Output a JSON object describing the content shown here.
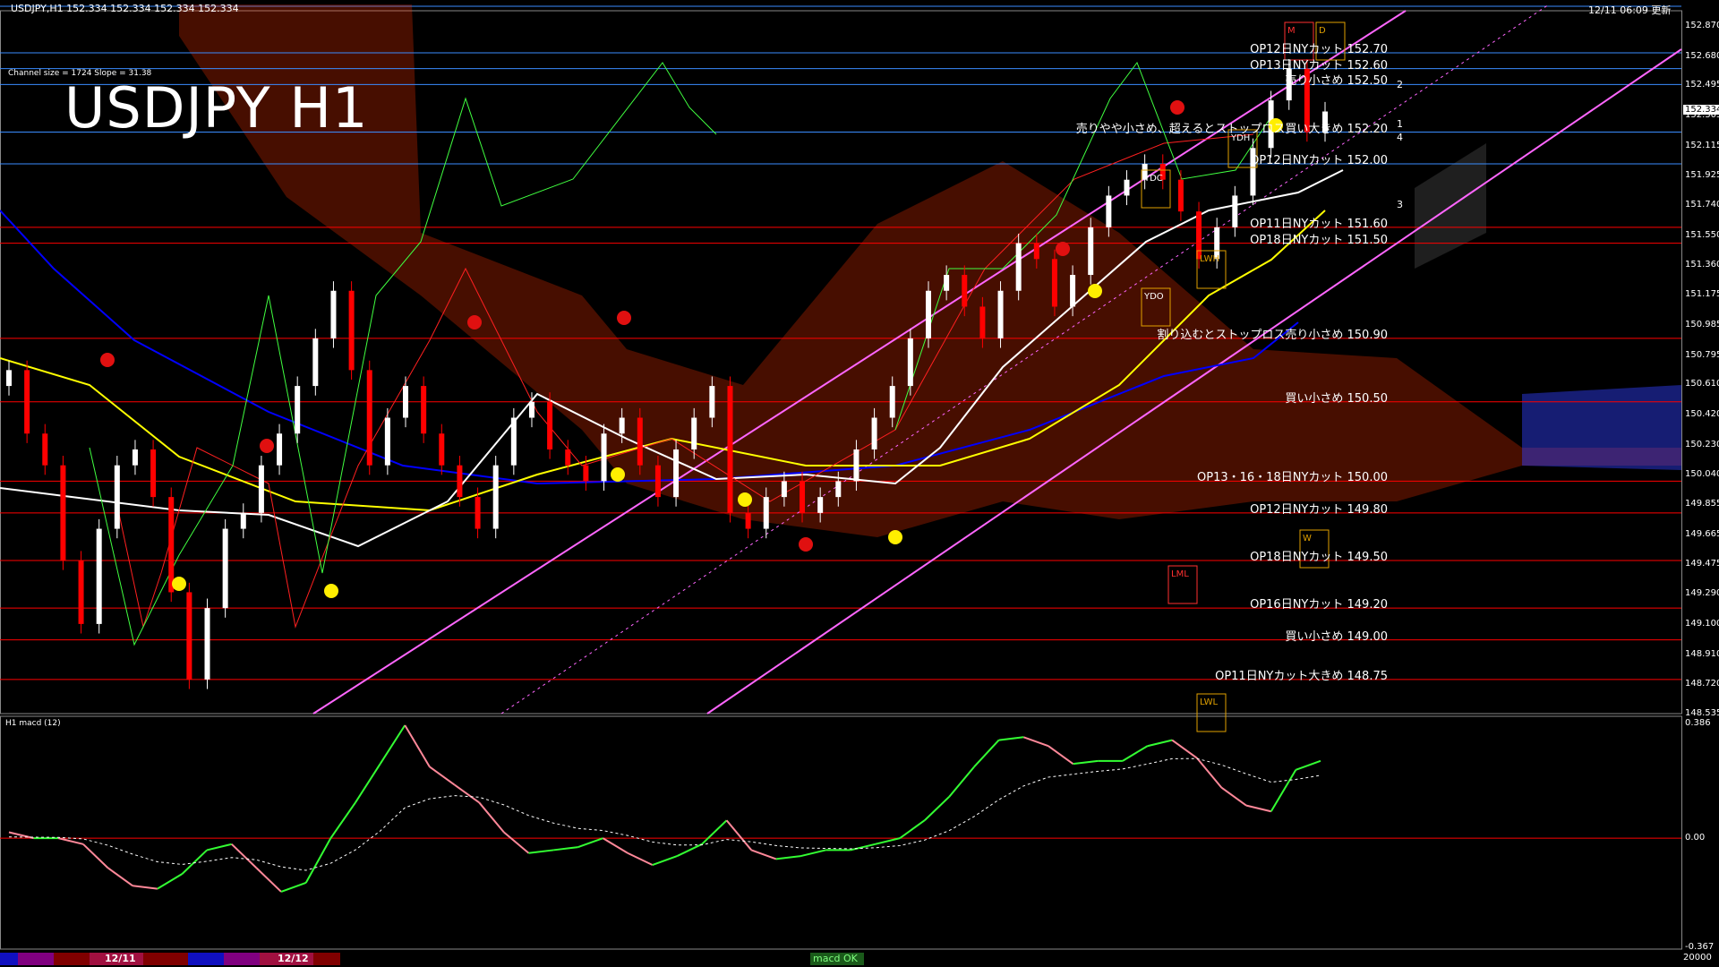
{
  "header": {
    "symbol_info": "USDJPY,H1  152.334 152.334 152.334 152.334",
    "timestamp": "12/11 06:09 更新",
    "channel_info": "Channel size = 1724 Slope = 31.38"
  },
  "chart_data": {
    "type": "candlestick",
    "title": "USDJPY H1",
    "ylim": [
      148.535,
      152.965
    ],
    "y_ticks": [
      "152.870",
      "152.680",
      "152.495",
      "152.305",
      "152.115",
      "151.925",
      "151.740",
      "151.550",
      "151.360",
      "151.175",
      "150.985",
      "150.795",
      "150.610",
      "150.420",
      "150.230",
      "150.040",
      "149.855",
      "149.665",
      "149.475",
      "149.290",
      "149.100",
      "148.910",
      "148.720",
      "148.535"
    ],
    "current_price": "152.334",
    "x_labels": [
      "12/11",
      "12/12"
    ],
    "trend_markers": [
      "2",
      "1",
      "4",
      "3"
    ],
    "levels": [
      {
        "label": "OP12日NYカット 152.70",
        "price": 152.7
      },
      {
        "label": "OP13日NYカット 152.60",
        "price": 152.6
      },
      {
        "label": "売り小さめ 152.50",
        "price": 152.5
      },
      {
        "label": "売りやや小さめ、超えるとストップロス買い大きめ 152.20",
        "price": 152.2
      },
      {
        "label": "OP12日NYカット 152.00",
        "price": 152.0
      },
      {
        "label": "OP11日NYカット 151.60",
        "price": 151.6
      },
      {
        "label": "OP18日NYカット 151.50",
        "price": 151.5
      },
      {
        "label": "割り込むとストップロス売り小さめ 150.90",
        "price": 150.9
      },
      {
        "label": "買い小さめ 150.50",
        "price": 150.5
      },
      {
        "label": "OP13・16・18日NYカット 150.00",
        "price": 150.0
      },
      {
        "label": "OP12日NYカット 149.80",
        "price": 149.8
      },
      {
        "label": "OP18日NYカット 149.50",
        "price": 149.5
      },
      {
        "label": "OP16日NYカット 149.20",
        "price": 149.2
      },
      {
        "label": "買い小さめ 149.00",
        "price": 149.0
      },
      {
        "label": "OP11日NYカット大きめ 148.75",
        "price": 148.75
      }
    ],
    "boxes": [
      "YDH",
      "YDC",
      "YDO",
      "LWH",
      "LML",
      "LWL",
      "M",
      "W",
      "D"
    ],
    "macd": {
      "label": "H1  macd (12)",
      "y_ticks": [
        "0.386",
        "0.00",
        "-0.367"
      ],
      "bottom_label": "20000",
      "status": "macd OK"
    }
  },
  "colors": {
    "background": "#000000",
    "support_line": "#ff0000",
    "resistance_line": "#3a8cff",
    "channel": "#ff66ff",
    "kumo": "#ff3300",
    "sma_white": "#ffffff",
    "sma_yellow": "#ffff00",
    "sma_blue": "#0000ff",
    "bull_candle": "#ffffff",
    "bear_candle": "#ff0000",
    "macd_up": "#33ff33",
    "macd_down": "#ff8899"
  }
}
